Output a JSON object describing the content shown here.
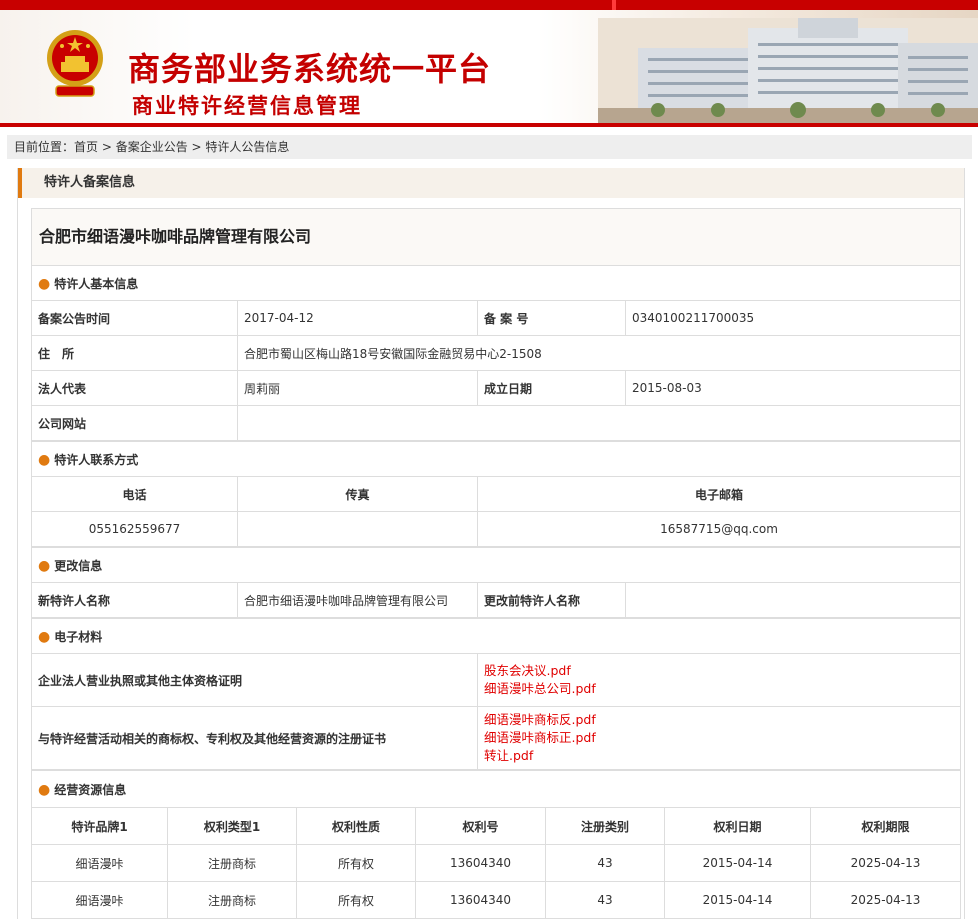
{
  "header": {
    "title": "商务部业务系统统一平台",
    "subtitle": "商业特许经营信息管理"
  },
  "breadcrumb": {
    "prefix": "目前位置：",
    "home": "首页",
    "sep1": " > ",
    "level2": "备案企业公告",
    "sep2": " > ",
    "current": "特许人公告信息"
  },
  "panel": {
    "title": "特许人备案信息",
    "company_name": "合肥市细语漫咔咖啡品牌管理有限公司"
  },
  "basic": {
    "section": "特许人基本信息",
    "announce_time_label": "备案公告时间",
    "announce_time": "2017-04-12",
    "record_no_label": "备 案 号",
    "record_no": "0340100211700035",
    "address_label": "住　所",
    "address": "合肥市蜀山区梅山路18号安徽国际金融贸易中心2-1508",
    "legal_rep_label": "法人代表",
    "legal_rep": "周莉丽",
    "founded_label": "成立日期",
    "founded": "2015-08-03",
    "website_label": "公司网站",
    "website": ""
  },
  "contact": {
    "section": "特许人联系方式",
    "phone_label": "电话",
    "fax_label": "传真",
    "email_label": "电子邮箱",
    "phone": "05516255967​7",
    "fax": "",
    "email": "16587715@qq.com"
  },
  "change": {
    "section": "更改信息",
    "new_name_label": "新特许人名称",
    "new_name": "合肥市细语漫咔咖啡品牌管理有限公司",
    "old_name_label": "更改前特许人名称",
    "old_name": ""
  },
  "materials": {
    "section": "电子材料",
    "row1_label": "企业法人营业执照或其他主体资格证明",
    "row1_files": [
      "股东会决议.pdf",
      "细语漫咔总公司.pdf"
    ],
    "row2_label": "与特许经营活动相关的商标权、专利权及其他经营资源的注册证书",
    "row2_files": [
      "细语漫咔商标反.pdf",
      "细语漫咔商标正.pdf",
      "转让.pdf"
    ]
  },
  "resources": {
    "section": "经营资源信息",
    "columns": [
      "特许品牌1",
      "权利类型1",
      "权利性质",
      "权利号",
      "注册类别",
      "权利日期",
      "权利期限"
    ],
    "rows": [
      [
        "细语漫咔",
        "注册商标",
        "所有权",
        "13604340",
        "43",
        "2015-04-14",
        "2025-04-13"
      ],
      [
        "细语漫咔",
        "注册商标",
        "所有权",
        "13604340",
        "43",
        "2015-04-14",
        "2025-04-13"
      ]
    ]
  },
  "colors": {
    "brand_red": "#c80000",
    "accent_orange": "#e07a10",
    "link_red": "#e00000"
  }
}
